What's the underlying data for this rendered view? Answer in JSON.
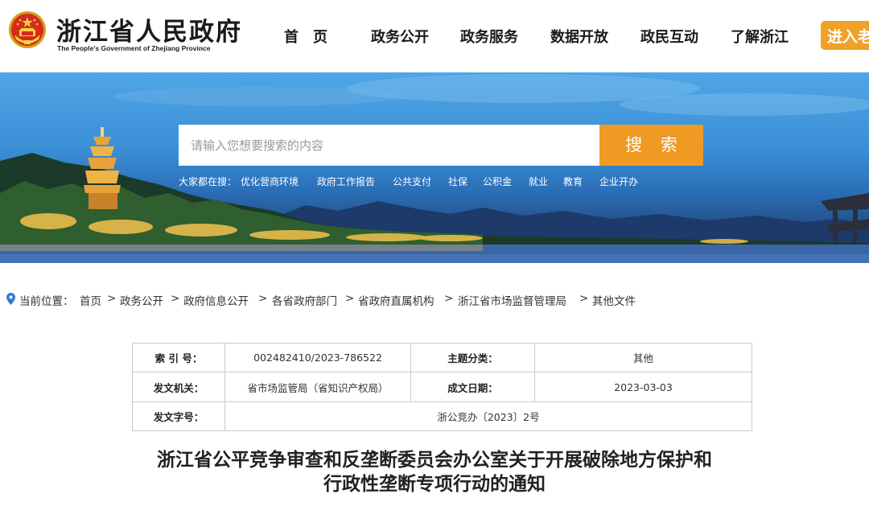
{
  "header": {
    "title": "浙江省人民政府",
    "subtitle": "The People's Government of Zhejiang Province",
    "nav": [
      "首　页",
      "政务公开",
      "政务服务",
      "数据开放",
      "政民互动",
      "了解浙江"
    ],
    "enter_label": "进入老",
    "accent": "#f0a12a"
  },
  "banner": {
    "search_placeholder": "请输入您想要搜索的内容",
    "search_button": "搜 索",
    "hot_label": "大家都在搜：",
    "hot_items": [
      "优化营商环境",
      "政府工作报告",
      "公共支付",
      "社保",
      "公积金",
      "就业",
      "教育",
      "企业开办"
    ]
  },
  "breadcrumb": {
    "prefix": "当前位置：",
    "items": [
      "首页",
      "政务公开",
      "政府信息公开",
      "各省政府部门",
      "省政府直属机构",
      "浙江省市场监督管理局",
      "其他文件"
    ],
    "separator": ">"
  },
  "meta": {
    "index_label": "索 引 号：",
    "index_value": "002482410/2023-786522",
    "topic_label": "主题分类：",
    "topic_value": "其他",
    "issuer_label": "发文机关：",
    "issuer_value": "省市场监管局（省知识产权局）",
    "date_label": "成文日期：",
    "date_value": "2023-03-03",
    "docno_label": "发文字号：",
    "docno_value": "浙公竞办〔2023〕2号"
  },
  "document": {
    "title_line1": "浙江省公平竞争审查和反垄断委员会办公室关于开展破除地方保护和",
    "title_line2": "行政性垄断专项行动的通知"
  }
}
